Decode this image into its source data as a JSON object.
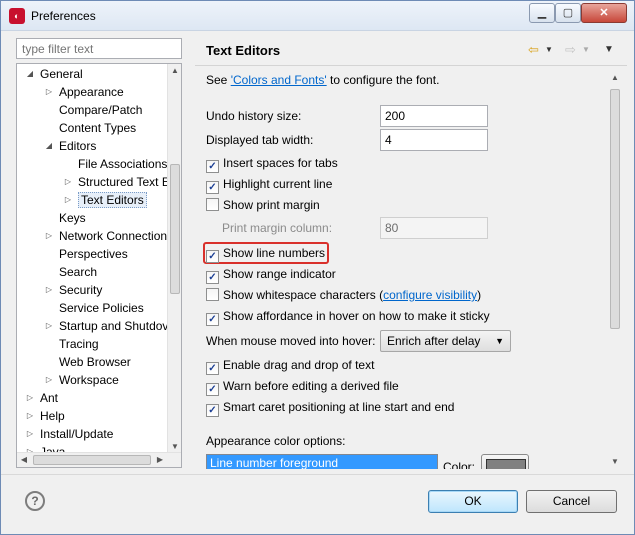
{
  "window": {
    "title": "Preferences"
  },
  "filter": {
    "placeholder": "type filter text"
  },
  "tree": [
    {
      "label": "General",
      "tri": "◢"
    },
    {
      "label": "Appearance",
      "tri": "▷"
    },
    {
      "label": "Compare/Patch",
      "tri": ""
    },
    {
      "label": "Content Types",
      "tri": ""
    },
    {
      "label": "Editors",
      "tri": "◢"
    },
    {
      "label": "File Associations",
      "tri": ""
    },
    {
      "label": "Structured Text E",
      "tri": "▷"
    },
    {
      "label": "Text Editors",
      "tri": "▷"
    },
    {
      "label": "Keys",
      "tri": ""
    },
    {
      "label": "Network Connection",
      "tri": "▷"
    },
    {
      "label": "Perspectives",
      "tri": ""
    },
    {
      "label": "Search",
      "tri": ""
    },
    {
      "label": "Security",
      "tri": "▷"
    },
    {
      "label": "Service Policies",
      "tri": ""
    },
    {
      "label": "Startup and Shutdov",
      "tri": "▷"
    },
    {
      "label": "Tracing",
      "tri": ""
    },
    {
      "label": "Web Browser",
      "tri": ""
    },
    {
      "label": "Workspace",
      "tri": "▷"
    },
    {
      "label": "Ant",
      "tri": "▷"
    },
    {
      "label": "Help",
      "tri": "▷"
    },
    {
      "label": "Install/Update",
      "tri": "▷"
    },
    {
      "label": "Java",
      "tri": "▷"
    }
  ],
  "page": {
    "title": "Text Editors",
    "see_prefix": "See ",
    "see_link": "'Colors and Fonts'",
    "see_suffix": " to configure the font.",
    "undo_label": "Undo history size:",
    "undo_value": "200",
    "tab_label": "Displayed tab width:",
    "tab_value": "4",
    "insert_spaces": "Insert spaces for tabs",
    "highlight_line": "Highlight current line",
    "print_margin": "Show print margin",
    "print_margin_col_label": "Print margin column:",
    "print_margin_col_value": "80",
    "line_numbers": "Show line numbers",
    "range_indicator": "Show range indicator",
    "whitespace": "Show whitespace characters",
    "configure_visibility": "configure visibility",
    "affordance": "Show affordance in hover on how to make it sticky",
    "hover_label": "When mouse moved into hover:",
    "hover_value": "Enrich after delay",
    "drag_drop": "Enable drag and drop of text",
    "warn_derived": "Warn before editing a derived file",
    "smart_caret": "Smart caret positioning at line start and end",
    "appearance_label": "Appearance color options:",
    "appearance_item": "Line number foreground",
    "color_label": "Color:",
    "swatch_color": "#808080"
  },
  "buttons": {
    "ok": "OK",
    "cancel": "Cancel",
    "help": "?"
  }
}
